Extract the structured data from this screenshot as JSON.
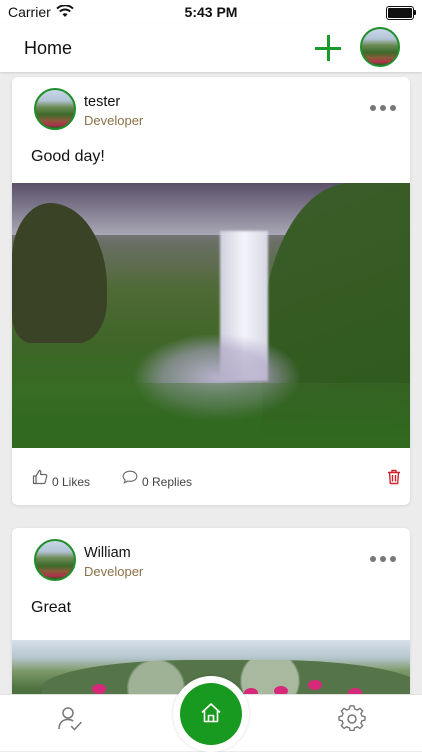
{
  "status_bar": {
    "carrier": "Carrier",
    "time": "5:43 PM"
  },
  "nav": {
    "title": "Home",
    "accent_color": "#1a9a2a"
  },
  "posts": [
    {
      "author": "tester",
      "role": "Developer",
      "text": "Good day!",
      "likes_label": "0 Likes",
      "replies_label": "0 Replies",
      "image": "waterfall-photo"
    },
    {
      "author": "William",
      "role": "Developer",
      "text": "Great",
      "image": "flowers-photo"
    }
  ],
  "tab_bar": {
    "items": [
      {
        "icon": "profile-check-icon"
      },
      {
        "icon": "home-icon",
        "active": true
      },
      {
        "icon": "gear-icon"
      }
    ],
    "active_color": "#18991f"
  },
  "colors": {
    "role_text": "#8a6f47",
    "delete": "#d0222b"
  }
}
